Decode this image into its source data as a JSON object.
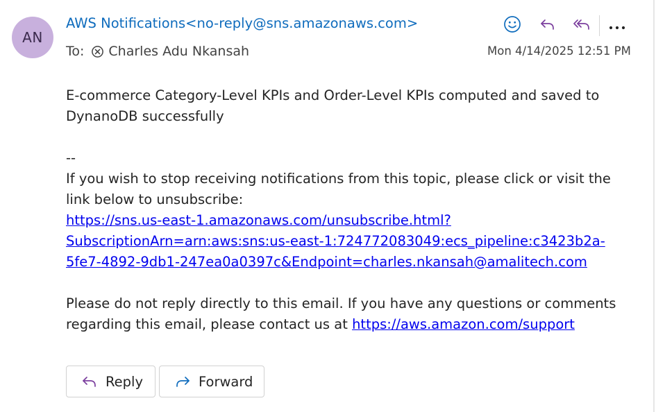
{
  "header": {
    "avatar_initials": "AN",
    "sender": "AWS Notifications<no-reply@sns.amazonaws.com>",
    "to_label": "To:",
    "recipient": "Charles Adu Nkansah",
    "timestamp": "Mon 4/14/2025 12:51 PM"
  },
  "toolbar": {
    "icons": [
      "smiley-icon",
      "reply-icon",
      "reply-all-icon",
      "more-icon"
    ]
  },
  "body": {
    "line1": "E-commerce Category-Level KPIs and Order-Level KPIs computed and saved to",
    "line2": "DynanoDB successfully",
    "separator": "--",
    "unsub_line1": "If you wish to stop receiving notifications from this topic, please click or visit the",
    "unsub_line2": "link below to unsubscribe:",
    "unsub_link1": "https://sns.us-east-1.amazonaws.com/unsubscribe.html?",
    "unsub_link2": "SubscriptionArn=arn:aws:sns:us-east-1:724772083049:ecs_pipeline:c3423b2a-",
    "unsub_link3": "5fe7-4892-9db1-247ea0a0397c&Endpoint=charles.nkansah@amalitech.com",
    "footer_line1": "Please do not reply directly to this email. If you have any questions or comments",
    "footer_line2_prefix": "regarding this email, please contact us at ",
    "support_link": "https://aws.amazon.com/support"
  },
  "actions": {
    "reply_label": "Reply",
    "forward_label": "Forward"
  },
  "colors": {
    "accent": "#0f6cbd",
    "link": "#0000ee",
    "reply_icon": "#7b3f9e",
    "avatar_bg": "#c8b0dd"
  }
}
